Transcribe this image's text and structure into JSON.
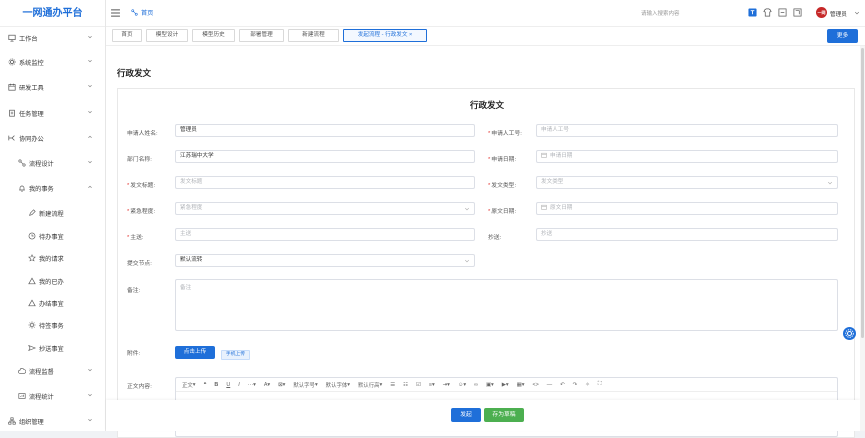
{
  "app": {
    "title": "一网通办平台"
  },
  "sidebar": {
    "items": [
      {
        "label": "工作台",
        "icon": "monitor-icon"
      },
      {
        "label": "系统监控",
        "icon": "gear-icon"
      },
      {
        "label": "研发工具",
        "icon": "calendar-icon"
      },
      {
        "label": "任务管理",
        "icon": "clipboard-icon"
      },
      {
        "label": "协同办公",
        "icon": "flow-icon"
      },
      {
        "label": "流程设计",
        "icon": "nodes-icon"
      },
      {
        "label": "我的事务",
        "icon": "bell-icon"
      },
      {
        "label": "新建流程",
        "icon": "pencil-icon"
      },
      {
        "label": "待办事宜",
        "icon": "clock-icon"
      },
      {
        "label": "我的请求",
        "icon": "star-icon"
      },
      {
        "label": "我的已办",
        "icon": "triangle-icon"
      },
      {
        "label": "办结事宜",
        "icon": "triangle-icon"
      },
      {
        "label": "待签事务",
        "icon": "sun-icon"
      },
      {
        "label": "抄送事宜",
        "icon": "send-icon"
      },
      {
        "label": "流程监督",
        "icon": "cloud-icon"
      },
      {
        "label": "流程统计",
        "icon": "chart-icon"
      },
      {
        "label": "组织管理",
        "icon": "org-icon"
      }
    ]
  },
  "topbar": {
    "home_label": "首页",
    "search_placeholder": "请输入搜索内容",
    "user_name": "管理员",
    "avatar_text": "一网"
  },
  "tags": [
    {
      "label": "首页"
    },
    {
      "label": "模型设计"
    },
    {
      "label": "模型历史"
    },
    {
      "label": "部署管理"
    },
    {
      "label": "新建流程"
    },
    {
      "label": "发起流程 - 行政发文 ×"
    }
  ],
  "more_label": "更多",
  "page": {
    "title": "行政发文"
  },
  "form": {
    "title": "行政发文",
    "applicant_name": {
      "label": "申请人姓名:",
      "value": "管理员"
    },
    "applicant_no": {
      "label": "申请人工号:",
      "placeholder": "申请人工号"
    },
    "department": {
      "label": "部门名称:",
      "value": "江苏瑞中大学"
    },
    "apply_date": {
      "label": "申请日期:",
      "placeholder": "申请日期"
    },
    "doc_title": {
      "label": "发文标题:",
      "placeholder": "发文标题"
    },
    "doc_type": {
      "label": "发文类型:",
      "placeholder": "发文类型"
    },
    "urgency": {
      "label": "紧急程度:",
      "placeholder": "紧急程度"
    },
    "doc_date": {
      "label": "原文日期:",
      "placeholder": "原文日期"
    },
    "main_send": {
      "label": "主送:",
      "placeholder": "主送"
    },
    "cc": {
      "label": "抄送:",
      "placeholder": "抄送"
    },
    "submit_node": {
      "label": "提交节点:",
      "value": "默认流转"
    },
    "remark": {
      "label": "备注:",
      "placeholder": "备注"
    },
    "attachment": {
      "label": "附件:",
      "upload_label": "点击上传",
      "mobile_label": "手机上传"
    },
    "body": {
      "label": "正文内容:"
    }
  },
  "editor_toolbar": {
    "para": "正文",
    "font_size": "默认字号",
    "font_family": "默认字体",
    "line_height": "默认行高"
  },
  "footer": {
    "submit_label": "发起",
    "draft_label": "存为草稿"
  }
}
